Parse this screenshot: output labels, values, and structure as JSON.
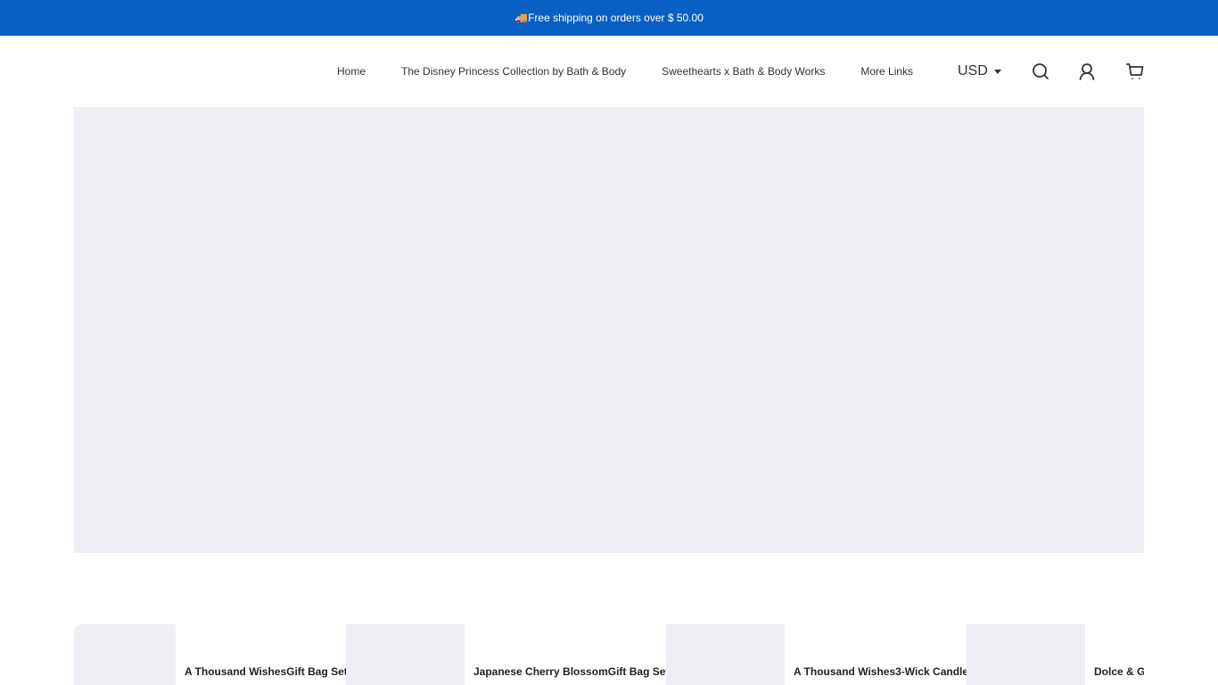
{
  "announcement": {
    "icon": "delivery-truck-emoji",
    "emoji": "🚚",
    "text": "Free shipping on orders over $ 50.00"
  },
  "nav": {
    "items": [
      {
        "label": "Home"
      },
      {
        "label": "The Disney Princess Collection by Bath & Body"
      },
      {
        "label": "Sweethearts x Bath & Body Works"
      },
      {
        "label": "More Links"
      }
    ]
  },
  "header": {
    "currency": "USD",
    "icons": [
      "search-icon",
      "account-icon",
      "cart-icon"
    ]
  },
  "products": [
    {
      "title": "A Thousand WishesGift Bag Set"
    },
    {
      "title": "Japanese Cherry BlossomGift Bag Set"
    },
    {
      "title": "A Thousand Wishes3-Wick Candle"
    },
    {
      "title": "Dolce & Ga"
    }
  ],
  "colors": {
    "announcement_bg": "#0a5fc4",
    "placeholder_bg": "#eeeff4"
  }
}
